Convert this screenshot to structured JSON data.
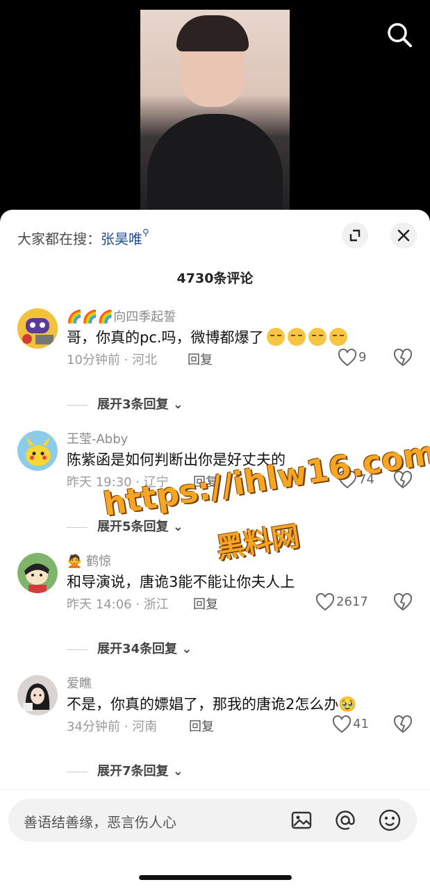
{
  "hot_search": {
    "prefix": "大家都在搜：",
    "keyword": "张昊唯"
  },
  "comment_count": "4730条评论",
  "comments": [
    {
      "user": "🌈🌈🌈向四季起誓",
      "text": "哥，你真的pc.吗，微博都爆了",
      "time_location": "10分钟前 · 河北",
      "reply_label": "回复",
      "likes": "9",
      "expand": "展开3条回复"
    },
    {
      "user": "王莹-Abby",
      "text": "陈紫函是如何判断出你是好丈夫的",
      "time_location": "昨天 19:30 · 辽宁",
      "reply_label": "回复",
      "likes": "74",
      "expand": "展开5条回复"
    },
    {
      "user": "🙅 鹤惊",
      "text": "和导演说，唐诡3能不能让你夫人上",
      "time_location": "昨天 14:06 · 浙江",
      "reply_label": "回复",
      "likes": "2617",
      "expand": "展开34条回复"
    },
    {
      "user": "爱瞧",
      "text": "不是，你真的嫖娼了，那我的唐诡2怎么办🥹",
      "time_location": "34分钟前 · 河南",
      "reply_label": "回复",
      "likes": "41",
      "expand": "展开7条回复"
    }
  ],
  "input": {
    "placeholder": "善语结善缘，恶言伤人心"
  },
  "watermark": {
    "url": "https://ihlw16.com",
    "name": "黑料网"
  },
  "colors": {
    "keyword": "#1c4e9c",
    "watermark": "#f6a623"
  }
}
